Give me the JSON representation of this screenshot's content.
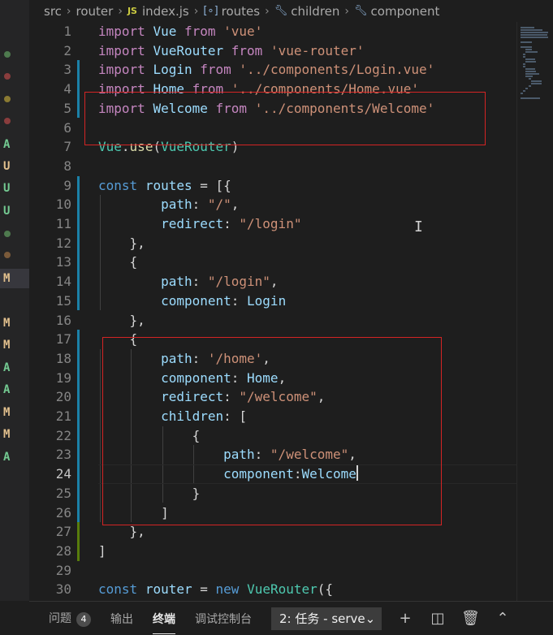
{
  "breadcrumb": [
    "src",
    "router",
    "index.js",
    "routes",
    "children",
    "component"
  ],
  "breadcrumb_icons": {
    "file": "js-file-icon",
    "variable": "variable-icon",
    "property": "wrench-icon"
  },
  "scm_markers": [
    {
      "kind": "dot",
      "color": "#4e7a4e"
    },
    {
      "kind": "dot",
      "color": "#8a3d3d"
    },
    {
      "kind": "dot",
      "color": "#8a7a32"
    },
    {
      "kind": "dot",
      "color": "#8a3d3d"
    },
    {
      "kind": "letter",
      "text": "A",
      "color": "#73c991"
    },
    {
      "kind": "letter",
      "text": "U",
      "color": "#e2c08d"
    },
    {
      "kind": "letter",
      "text": "U",
      "color": "#73c991"
    },
    {
      "kind": "letter",
      "text": "U",
      "color": "#73c991"
    },
    {
      "kind": "dot",
      "color": "#4e7a4e"
    },
    {
      "kind": "dot",
      "color": "#7a5a3a"
    },
    {
      "kind": "letter",
      "text": "M",
      "color": "#e2c08d",
      "selected": true
    },
    {
      "kind": "blank"
    },
    {
      "kind": "letter",
      "text": "M",
      "color": "#e2c08d"
    },
    {
      "kind": "letter",
      "text": "M",
      "color": "#e2c08d"
    },
    {
      "kind": "letter",
      "text": "A",
      "color": "#73c991"
    },
    {
      "kind": "letter",
      "text": "A",
      "color": "#73c991"
    },
    {
      "kind": "letter",
      "text": "M",
      "color": "#e2c08d"
    },
    {
      "kind": "letter",
      "text": "M",
      "color": "#e2c08d"
    },
    {
      "kind": "letter",
      "text": "A",
      "color": "#73c991"
    }
  ],
  "code": {
    "active_line": 24,
    "lines": [
      [
        [
          "k",
          "import"
        ],
        [
          "p",
          " "
        ],
        [
          "v",
          "Vue"
        ],
        [
          "p",
          " "
        ],
        [
          "k",
          "from"
        ],
        [
          "p",
          " "
        ],
        [
          "s",
          "'vue'"
        ]
      ],
      [
        [
          "k",
          "import"
        ],
        [
          "p",
          " "
        ],
        [
          "v",
          "VueRouter"
        ],
        [
          "p",
          " "
        ],
        [
          "k",
          "from"
        ],
        [
          "p",
          " "
        ],
        [
          "s",
          "'vue-router'"
        ]
      ],
      [
        [
          "k",
          "import"
        ],
        [
          "p",
          " "
        ],
        [
          "v",
          "Login"
        ],
        [
          "p",
          " "
        ],
        [
          "k",
          "from"
        ],
        [
          "p",
          " "
        ],
        [
          "s",
          "'../components/Login.vue'"
        ]
      ],
      [
        [
          "k",
          "import"
        ],
        [
          "p",
          " "
        ],
        [
          "v",
          "Home"
        ],
        [
          "p",
          " "
        ],
        [
          "k",
          "from"
        ],
        [
          "p",
          " "
        ],
        [
          "s",
          "'../components/Home.vue'"
        ]
      ],
      [
        [
          "k",
          "import"
        ],
        [
          "p",
          " "
        ],
        [
          "v",
          "Welcome"
        ],
        [
          "p",
          " "
        ],
        [
          "k",
          "from"
        ],
        [
          "p",
          " "
        ],
        [
          "s",
          "'../components/Welcome'"
        ]
      ],
      [],
      [
        [
          "t",
          "Vue"
        ],
        [
          "p",
          "."
        ],
        [
          "f",
          "use"
        ],
        [
          "p",
          "("
        ],
        [
          "t",
          "VueRouter"
        ],
        [
          "p",
          ")"
        ]
      ],
      [],
      [
        [
          "kb",
          "const"
        ],
        [
          "p",
          " "
        ],
        [
          "v",
          "routes"
        ],
        [
          "p",
          " = [{"
        ]
      ],
      [
        [
          "p",
          "        "
        ],
        [
          "v",
          "path"
        ],
        [
          "p",
          ": "
        ],
        [
          "s",
          "\"/\""
        ],
        [
          "p",
          ","
        ]
      ],
      [
        [
          "p",
          "        "
        ],
        [
          "v",
          "redirect"
        ],
        [
          "p",
          ": "
        ],
        [
          "s",
          "\"/login\""
        ]
      ],
      [
        [
          "p",
          "    },"
        ]
      ],
      [
        [
          "p",
          "    {"
        ]
      ],
      [
        [
          "p",
          "        "
        ],
        [
          "v",
          "path"
        ],
        [
          "p",
          ": "
        ],
        [
          "s",
          "\"/login\""
        ],
        [
          "p",
          ","
        ]
      ],
      [
        [
          "p",
          "        "
        ],
        [
          "v",
          "component"
        ],
        [
          "p",
          ": "
        ],
        [
          "v",
          "Login"
        ]
      ],
      [
        [
          "p",
          "    },"
        ]
      ],
      [
        [
          "p",
          "    {"
        ]
      ],
      [
        [
          "p",
          "        "
        ],
        [
          "v",
          "path"
        ],
        [
          "p",
          ": "
        ],
        [
          "s",
          "'/home'"
        ],
        [
          "p",
          ","
        ]
      ],
      [
        [
          "p",
          "        "
        ],
        [
          "v",
          "component"
        ],
        [
          "p",
          ": "
        ],
        [
          "v",
          "Home"
        ],
        [
          "p",
          ","
        ]
      ],
      [
        [
          "p",
          "        "
        ],
        [
          "v",
          "redirect"
        ],
        [
          "p",
          ": "
        ],
        [
          "s",
          "\"/welcome\""
        ],
        [
          "p",
          ","
        ]
      ],
      [
        [
          "p",
          "        "
        ],
        [
          "v",
          "children"
        ],
        [
          "p",
          ": ["
        ]
      ],
      [
        [
          "p",
          "            {"
        ]
      ],
      [
        [
          "p",
          "                "
        ],
        [
          "v",
          "path"
        ],
        [
          "p",
          ": "
        ],
        [
          "s",
          "\"/welcome\""
        ],
        [
          "p",
          ","
        ]
      ],
      [
        [
          "p",
          "                "
        ],
        [
          "v",
          "component"
        ],
        [
          "p",
          ":"
        ],
        [
          "v",
          "Welcome"
        ],
        [
          "cursor",
          ""
        ]
      ],
      [
        [
          "p",
          "            }"
        ]
      ],
      [
        [
          "p",
          "        ]"
        ]
      ],
      [
        [
          "p",
          "    },"
        ]
      ],
      [
        [
          "p",
          "]"
        ]
      ],
      [],
      [
        [
          "kb",
          "const"
        ],
        [
          "p",
          " "
        ],
        [
          "v",
          "router"
        ],
        [
          "p",
          " = "
        ],
        [
          "kb",
          "new"
        ],
        [
          "p",
          " "
        ],
        [
          "t",
          "VueRouter"
        ],
        [
          "p",
          "({"
        ]
      ]
    ]
  },
  "gutter_changes": [
    {
      "from": 3,
      "to": 5,
      "color": "#1b81a8"
    },
    {
      "from": 9,
      "to": 15,
      "color": "#1b81a8"
    },
    {
      "from": 17,
      "to": 26,
      "color": "#1b81a8"
    },
    {
      "from": 27,
      "to": 28,
      "color": "#587c0c"
    }
  ],
  "panel": {
    "tabs": [
      {
        "label": "问题",
        "badge": "4"
      },
      {
        "label": "输出"
      },
      {
        "label": "终端",
        "active": true
      },
      {
        "label": "调试控制台"
      }
    ],
    "terminal_select": "2: 任务 - serve",
    "actions": [
      "add-icon",
      "split-icon",
      "trash-icon",
      "chevron-up-icon"
    ]
  }
}
